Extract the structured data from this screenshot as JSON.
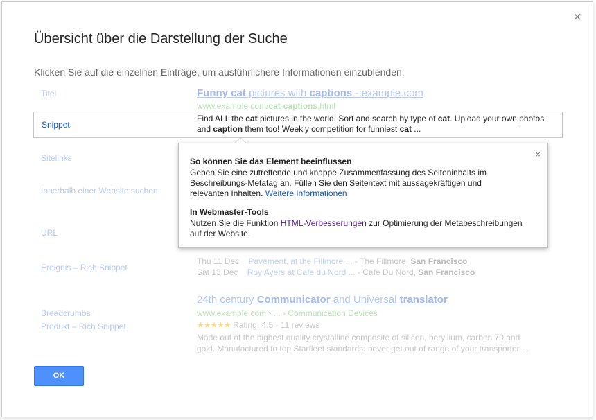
{
  "dialog": {
    "close_glyph": "×",
    "title": "Übersicht über die Darstellung der Suche",
    "subtitle": "Klicken Sie auf die einzelnen Einträge, um ausführlichere Informationen einzublenden."
  },
  "labels": {
    "titel": "Titel",
    "snippet": "Snippet",
    "sitelinks": "Sitelinks",
    "innerhalb": "Innerhalb einer Website suchen",
    "url": "URL",
    "ereignis": "Ereignis – Rich Snippet",
    "breadcrumbs": "Breadcrumbs",
    "produkt": "Produkt – Rich Snippet"
  },
  "result1": {
    "title_a": "Funny ",
    "title_b": "cat",
    "title_c": " pictures with ",
    "title_d": "captions",
    "title_e": " - example.com",
    "url_a": "www.example.com/",
    "url_b": "cat",
    "url_c": "-",
    "url_d": "captions",
    "url_e": ".html",
    "snippet_a": "Find ALL the ",
    "snippet_b": "cat",
    "snippet_c": " pictures in the world. Sort and search by type of ",
    "snippet_d": "cat",
    "snippet_e": ". Upload your own photos and ",
    "snippet_f": "caption",
    "snippet_g": " them too! Weekly competition for funniest ",
    "snippet_h": "cat",
    "snippet_i": " ..."
  },
  "events": [
    {
      "date": "Thu 11 Dec",
      "name": "Pavement, at the Fillmore ...",
      "venue": " - The Fillmore, ",
      "city": "San Francisco"
    },
    {
      "date": "Sat 13 Dec",
      "name": "Roy Ayers at Cafe du Nord ...",
      "venue": " - Cafe Du Nord, ",
      "city": "San Francisco"
    }
  ],
  "result2": {
    "title_a": "24th century ",
    "title_b": "Communicator",
    "title_c": " and Universal ",
    "title_d": "translator",
    "crumb": "www.example.com › ... › Communication Devices",
    "stars": "★★★★★",
    "rating": " Rating: 4.5 - 11 reviews",
    "desc1": "Made out of the highest quality crystalline composite of silicon, beryllium, carbon 70 and",
    "desc2": "gold. Manufactured to top Starfleet standards: never get out of range of your transporter ..."
  },
  "popup": {
    "close_glyph": "×",
    "h1": "So können Sie das Element beeinflussen",
    "p1": "Geben Sie eine zutreffende und knappe Zusammenfassung des Seiteninhalts im Beschreibungs-Metatag an. Füllen Sie den Seitentext mit aussagekräftigen und relevanten Inhalten. ",
    "link1": "Weitere Informationen",
    "h2": "In Webmaster-Tools",
    "p2a": "Nutzen Sie die Funktion ",
    "link2": "HTML-Verbesserungen",
    "p2b": " zur Optimierung der Metabeschreibungen auf der Website."
  },
  "ok_label": "OK",
  "colors": {
    "accent": "#4d90fe",
    "link": "#1155cc",
    "visited": "#551a8b"
  }
}
